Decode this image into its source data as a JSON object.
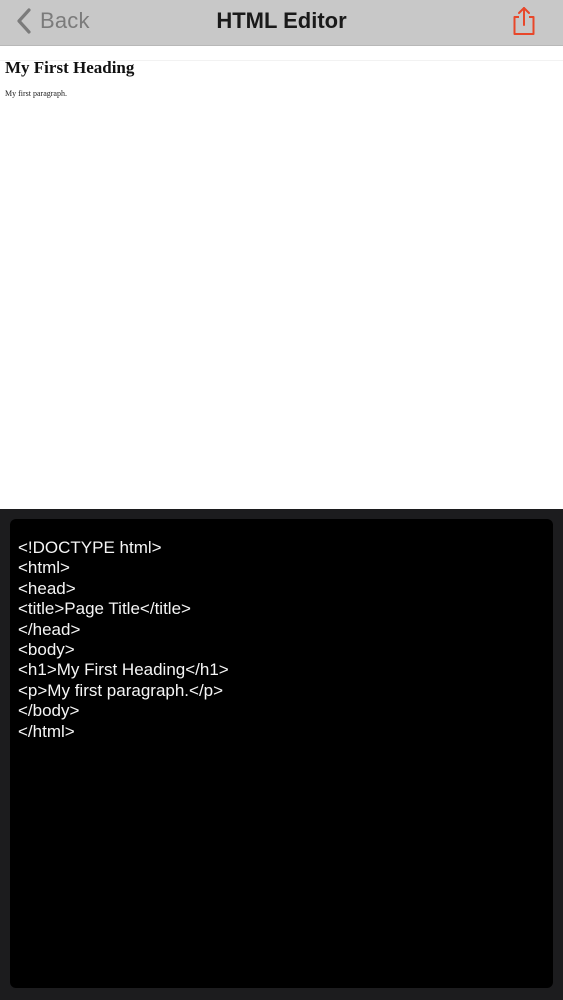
{
  "navbar": {
    "back_label": "Back",
    "title": "HTML Editor",
    "back_icon": "chevron-left-icon",
    "share_icon": "share-icon",
    "accent_color": "#e8472a"
  },
  "preview": {
    "heading": "My First Heading",
    "paragraph": "My first paragraph."
  },
  "editor": {
    "lines": [
      "<!DOCTYPE html>",
      "<html>",
      "<head>",
      "<title>Page Title</title>",
      "</head>",
      "<body>",
      "<h1>My First Heading</h1>",
      "<p>My first paragraph.</p>",
      "</body>",
      "</html>"
    ]
  }
}
